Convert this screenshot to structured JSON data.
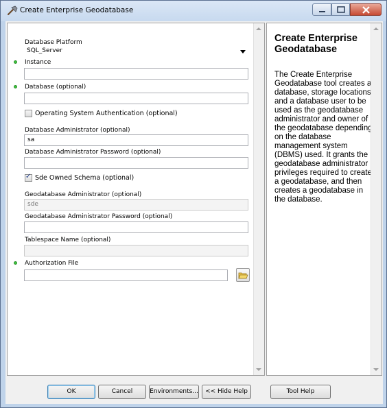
{
  "window": {
    "title": "Create Enterprise Geodatabase",
    "buttons": [
      "minimize",
      "maximize",
      "close"
    ]
  },
  "form": {
    "database_platform": {
      "label": "Database Platform",
      "value": "SQL_Server"
    },
    "instance": {
      "label": "Instance",
      "value": ""
    },
    "database": {
      "label": "Database (optional)",
      "value": ""
    },
    "os_auth": {
      "label": "Operating System Authentication (optional)",
      "checked": false
    },
    "db_admin": {
      "label": "Database Administrator (optional)",
      "value": "sa"
    },
    "db_admin_password": {
      "label": "Database Administrator Password (optional)",
      "value": ""
    },
    "sde_owned_schema": {
      "label": "Sde Owned Schema (optional)",
      "checked": true
    },
    "gdb_admin": {
      "label": "Geodatabase Administrator (optional)",
      "value": "sde"
    },
    "gdb_admin_password": {
      "label": "Geodatabase Administrator Password (optional)",
      "value": ""
    },
    "tablespace": {
      "label": "Tablespace Name (optional)",
      "value": ""
    },
    "auth_file": {
      "label": "Authorization File",
      "value": ""
    }
  },
  "help": {
    "title": "Create Enterprise Geodatabase",
    "body": "The Create Enterprise Geodatabase tool creates a database, storage locations, and a database user to be used as the geodatabase administrator and owner of the geodatabase depending on the database management system (DBMS) used. It grants the geodatabase administrator privileges required to create a geodatabase, and then creates a geodatabase in the database."
  },
  "buttons": {
    "ok": "OK",
    "cancel": "Cancel",
    "environments": "Environments...",
    "hide_help": "<< Hide Help",
    "tool_help": "Tool Help"
  },
  "icons": {
    "title": "hammer-icon",
    "browse": "open-folder-icon"
  },
  "colors": {
    "required_dot": "#3ec43e",
    "close_button": "#c74b34"
  }
}
